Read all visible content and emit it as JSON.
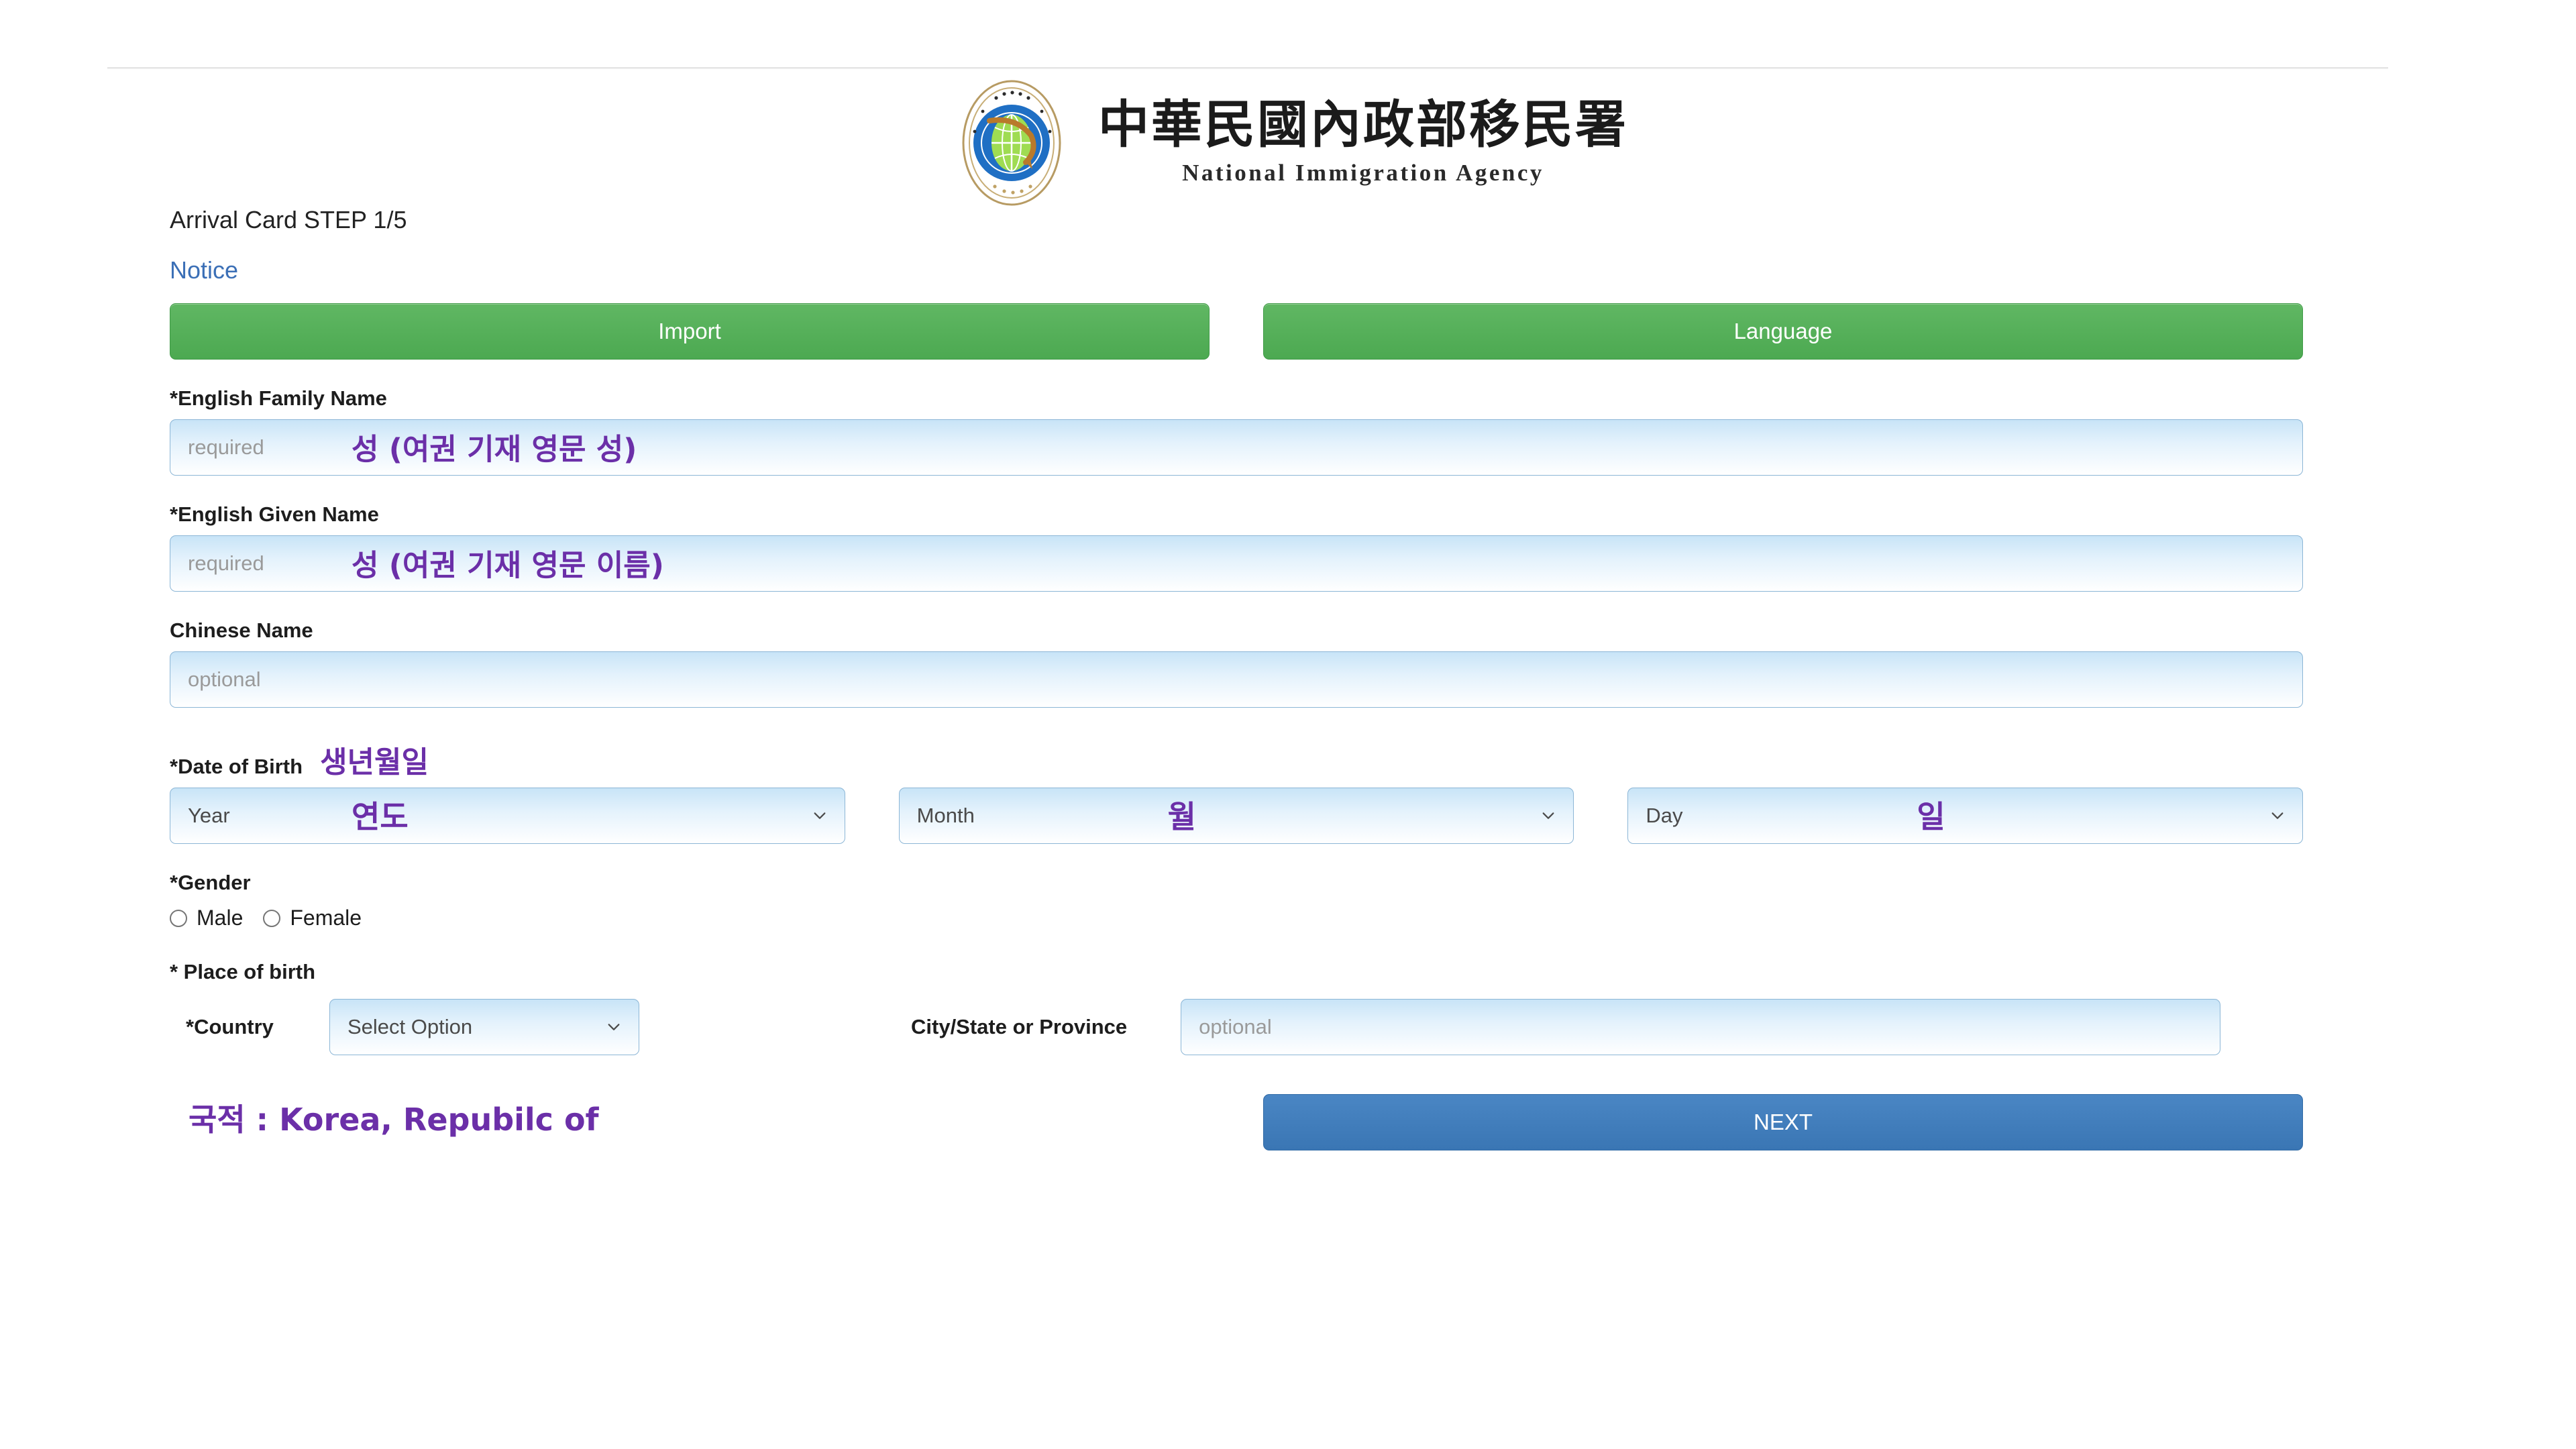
{
  "header": {
    "logo_icon": "national-immigration-agency-seal",
    "agency_name_cn": "中華民國內政部移民署",
    "agency_name_en": "National Immigration Agency"
  },
  "form": {
    "step_title": "Arrival Card STEP 1/5",
    "notice_label": "Notice",
    "buttons": {
      "import_label": "Import",
      "language_label": "Language",
      "next_label": "NEXT"
    },
    "fields": {
      "family_name": {
        "label": "*English Family Name",
        "placeholder": "required",
        "value": "",
        "annotation": "성 (여권 기재 영문 성)"
      },
      "given_name": {
        "label": "*English Given Name",
        "placeholder": "required",
        "value": "",
        "annotation": "성 (여권 기재 영문 이름)"
      },
      "chinese_name": {
        "label": "Chinese Name",
        "placeholder": "optional",
        "value": ""
      },
      "date_of_birth": {
        "label": "*Date of Birth",
        "annotation": "생년월일",
        "year": {
          "selected": "Year",
          "annotation": "연도"
        },
        "month": {
          "selected": "Month",
          "annotation": "월"
        },
        "day": {
          "selected": "Day",
          "annotation": "일"
        }
      },
      "gender": {
        "label": "*Gender",
        "options": [
          {
            "label": "Male",
            "checked": false
          },
          {
            "label": "Female",
            "checked": false
          }
        ]
      },
      "place_of_birth": {
        "label": "* Place of birth",
        "country": {
          "label": "*Country",
          "selected": "Select Option",
          "annotation": "국적 : Korea, Repubilc of"
        },
        "city_state": {
          "label": "City/State or Province",
          "placeholder": "optional",
          "value": ""
        }
      }
    }
  },
  "colors": {
    "green_button": "#4ca951",
    "blue_button": "#3a76b4",
    "link_blue": "#3b6fb6",
    "annotation_purple": "#6b2fa8",
    "field_border": "#8cb6d6"
  }
}
